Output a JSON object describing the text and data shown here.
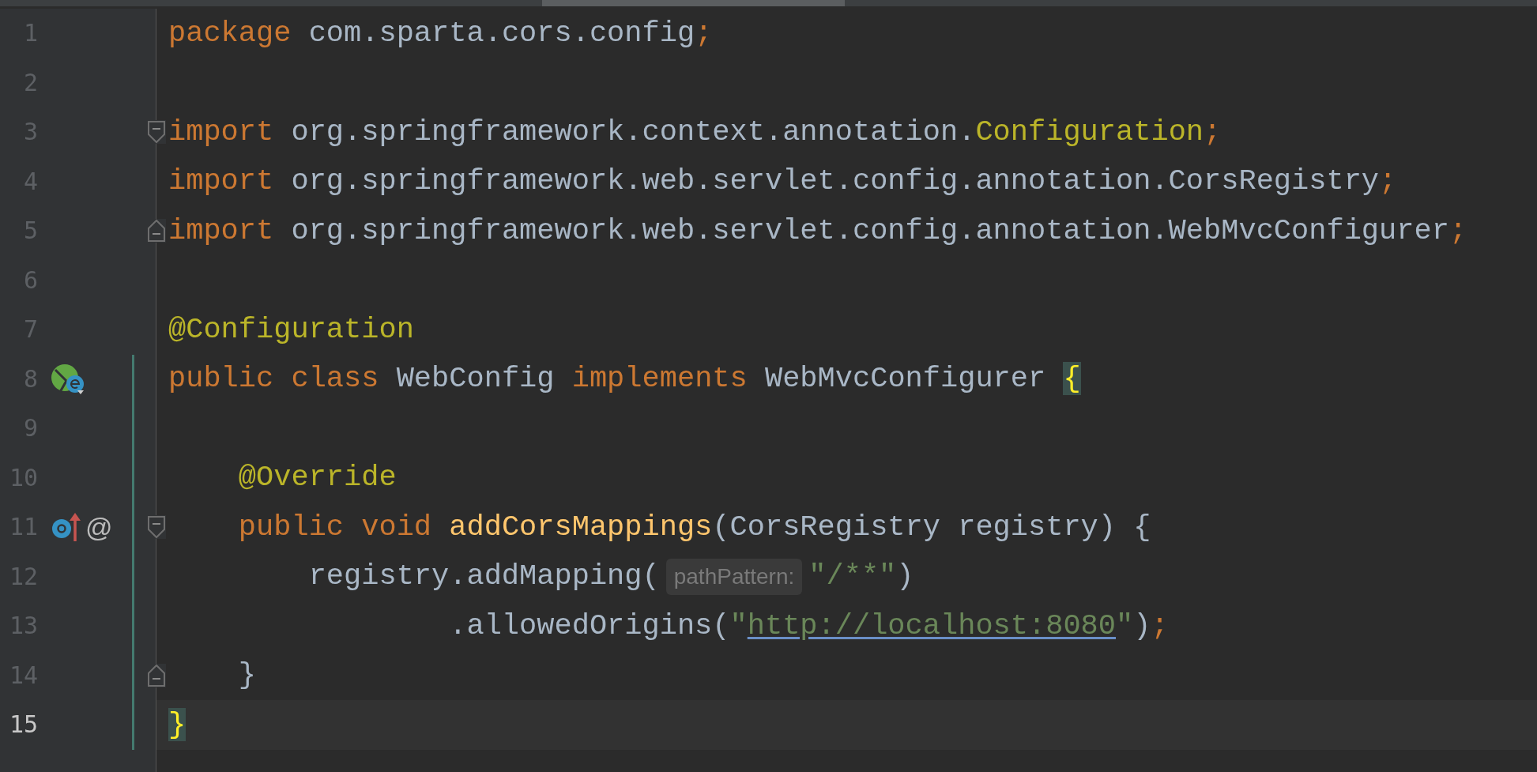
{
  "editor": {
    "lines": [
      {
        "number": "1",
        "current": false,
        "changed": false,
        "fold_start": false,
        "fold_end": false,
        "tokens": [
          {
            "kind": "keyword",
            "text": "package "
          },
          {
            "kind": "plain",
            "text": "com.sparta.cors.config"
          },
          {
            "kind": "keyword",
            "text": ";"
          }
        ]
      },
      {
        "number": "2",
        "current": false,
        "changed": false,
        "fold_start": false,
        "fold_end": false
      },
      {
        "number": "3",
        "current": false,
        "changed": false,
        "fold_start": true,
        "fold_end": false,
        "tokens": [
          {
            "kind": "keyword",
            "text": "import "
          },
          {
            "kind": "plain",
            "text": "org.springframework.context.annotation."
          },
          {
            "kind": "annotation",
            "text": "Configuration"
          },
          {
            "kind": "keyword",
            "text": ";"
          }
        ]
      },
      {
        "number": "4",
        "current": false,
        "changed": false,
        "fold_start": false,
        "fold_end": false,
        "tokens": [
          {
            "kind": "keyword",
            "text": "import "
          },
          {
            "kind": "plain",
            "text": "org.springframework.web.servlet.config.annotation.CorsRegistry"
          },
          {
            "kind": "keyword",
            "text": ";"
          }
        ]
      },
      {
        "number": "5",
        "current": false,
        "changed": false,
        "fold_start": false,
        "fold_end": true,
        "tokens": [
          {
            "kind": "keyword",
            "text": "import "
          },
          {
            "kind": "plain",
            "text": "org.springframework.web.servlet.config.annotation.WebMvcConfigurer"
          },
          {
            "kind": "keyword",
            "text": ";"
          }
        ]
      },
      {
        "number": "6",
        "current": false,
        "changed": false,
        "fold_start": false,
        "fold_end": false
      },
      {
        "number": "7",
        "current": false,
        "changed": false,
        "fold_start": false,
        "fold_end": false,
        "tokens": [
          {
            "kind": "annotation",
            "text": "@Configuration"
          }
        ]
      },
      {
        "number": "8",
        "current": false,
        "changed": true,
        "fold_start": false,
        "fold_end": false,
        "gutter_icons": [
          {
            "kind": "bean"
          }
        ],
        "tokens": [
          {
            "kind": "keyword",
            "text": "public class "
          },
          {
            "kind": "plain",
            "text": "WebConfig "
          },
          {
            "kind": "keyword",
            "text": "implements "
          },
          {
            "kind": "plain",
            "text": "WebMvcConfigurer "
          },
          {
            "kind": "brace_match",
            "text": "{"
          }
        ]
      },
      {
        "number": "9",
        "current": false,
        "changed": true,
        "fold_start": false,
        "fold_end": false
      },
      {
        "number": "10",
        "current": false,
        "changed": true,
        "fold_start": false,
        "fold_end": false,
        "tokens": [
          {
            "kind": "annotation",
            "text": "    @Override"
          }
        ]
      },
      {
        "number": "11",
        "current": false,
        "changed": true,
        "fold_start": true,
        "fold_end": false,
        "gutter_icons": [
          {
            "kind": "implements"
          },
          {
            "kind": "glyph",
            "text": "@"
          }
        ],
        "tokens": [
          {
            "kind": "keyword",
            "text": "    public void "
          },
          {
            "kind": "method",
            "text": "addCorsMappings"
          },
          {
            "kind": "plain",
            "text": "(CorsRegistry registry) {"
          }
        ]
      },
      {
        "number": "12",
        "current": false,
        "changed": true,
        "fold_start": false,
        "fold_end": false,
        "tokens": [
          {
            "kind": "plain",
            "text": "        registry.addMapping("
          },
          {
            "kind": "hint",
            "text": "pathPattern:"
          },
          {
            "kind": "string",
            "text": "\"/**\""
          },
          {
            "kind": "plain",
            "text": ")"
          }
        ]
      },
      {
        "number": "13",
        "current": false,
        "changed": true,
        "fold_start": false,
        "fold_end": false,
        "tokens": [
          {
            "kind": "plain",
            "text": "                .allowedOrigins("
          },
          {
            "kind": "string",
            "text": "\""
          },
          {
            "kind": "link",
            "text": "http://localhost:8080"
          },
          {
            "kind": "string",
            "text": "\""
          },
          {
            "kind": "plain",
            "text": ")"
          },
          {
            "kind": "keyword",
            "text": ";"
          }
        ]
      },
      {
        "number": "14",
        "current": false,
        "changed": true,
        "fold_start": false,
        "fold_end": true,
        "tokens": [
          {
            "kind": "plain",
            "text": "    }"
          }
        ]
      },
      {
        "number": "15",
        "current": true,
        "changed": true,
        "fold_start": false,
        "fold_end": false,
        "tokens": [
          {
            "kind": "brace_match",
            "text": "}"
          }
        ]
      }
    ]
  }
}
